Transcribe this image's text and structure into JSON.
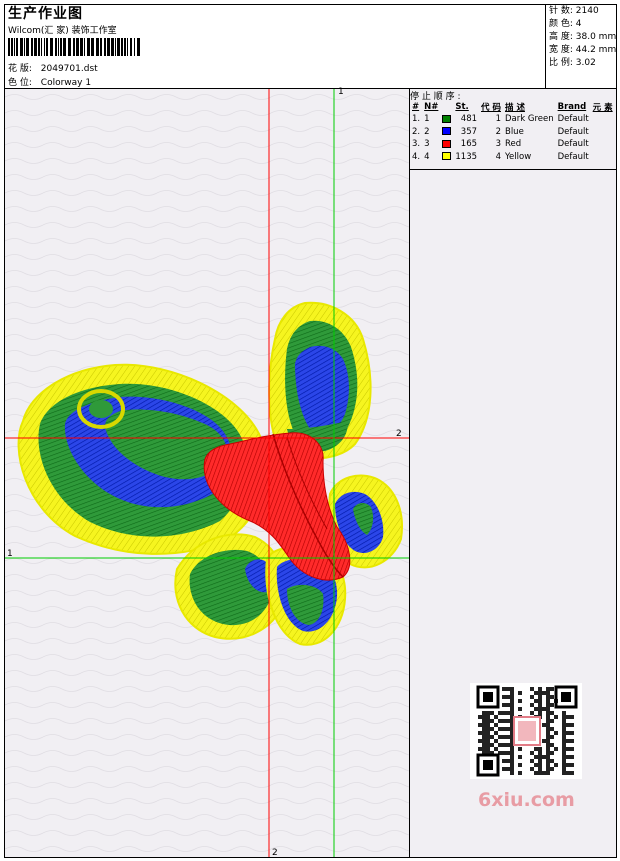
{
  "header": {
    "title": "生产作业图",
    "company": "Wilcom(汇 家) 装饰工作室",
    "design_label": "花 版:",
    "design_value": "2049701.dst",
    "colorway_label": "色 位:",
    "colorway_value": "Colorway 1"
  },
  "stats": [
    {
      "label": "针 数:",
      "value": "2140"
    },
    {
      "label": "颜 色:",
      "value": "4"
    },
    {
      "label": "高 度:",
      "value": "38.0 mm"
    },
    {
      "label": "宽 度:",
      "value": "44.2 mm"
    },
    {
      "label": "比 例:",
      "value": "3.02"
    }
  ],
  "stop_sequence": {
    "title": "停 止 顺 序 :",
    "columns": [
      "#",
      "N#",
      "St.",
      "代 码",
      "描 述",
      "Brand",
      "元 素"
    ],
    "rows": [
      {
        "idx": "1.",
        "n": "1",
        "color": "#008000",
        "st": "481",
        "code": "1",
        "desc": "Dark Green",
        "brand": "Default"
      },
      {
        "idx": "2.",
        "n": "2",
        "color": "#0000ff",
        "st": "357",
        "code": "2",
        "desc": "Blue",
        "brand": "Default"
      },
      {
        "idx": "3.",
        "n": "3",
        "color": "#ff0000",
        "st": "165",
        "code": "3",
        "desc": "Red",
        "brand": "Default"
      },
      {
        "idx": "4.",
        "n": "4",
        "color": "#ffff00",
        "st": "1135",
        "code": "4",
        "desc": "Yellow",
        "brand": "Default"
      }
    ]
  },
  "axes": {
    "green_v": "1",
    "green_h": "1",
    "red_h": "2",
    "red_v": "2"
  },
  "colors": {
    "dark_green": "#008000",
    "blue": "#0000ff",
    "red": "#ff0000",
    "yellow": "#ffff00",
    "guide_red": "#ff0000",
    "guide_green": "#00cc00"
  },
  "watermark": "6xiu.com"
}
